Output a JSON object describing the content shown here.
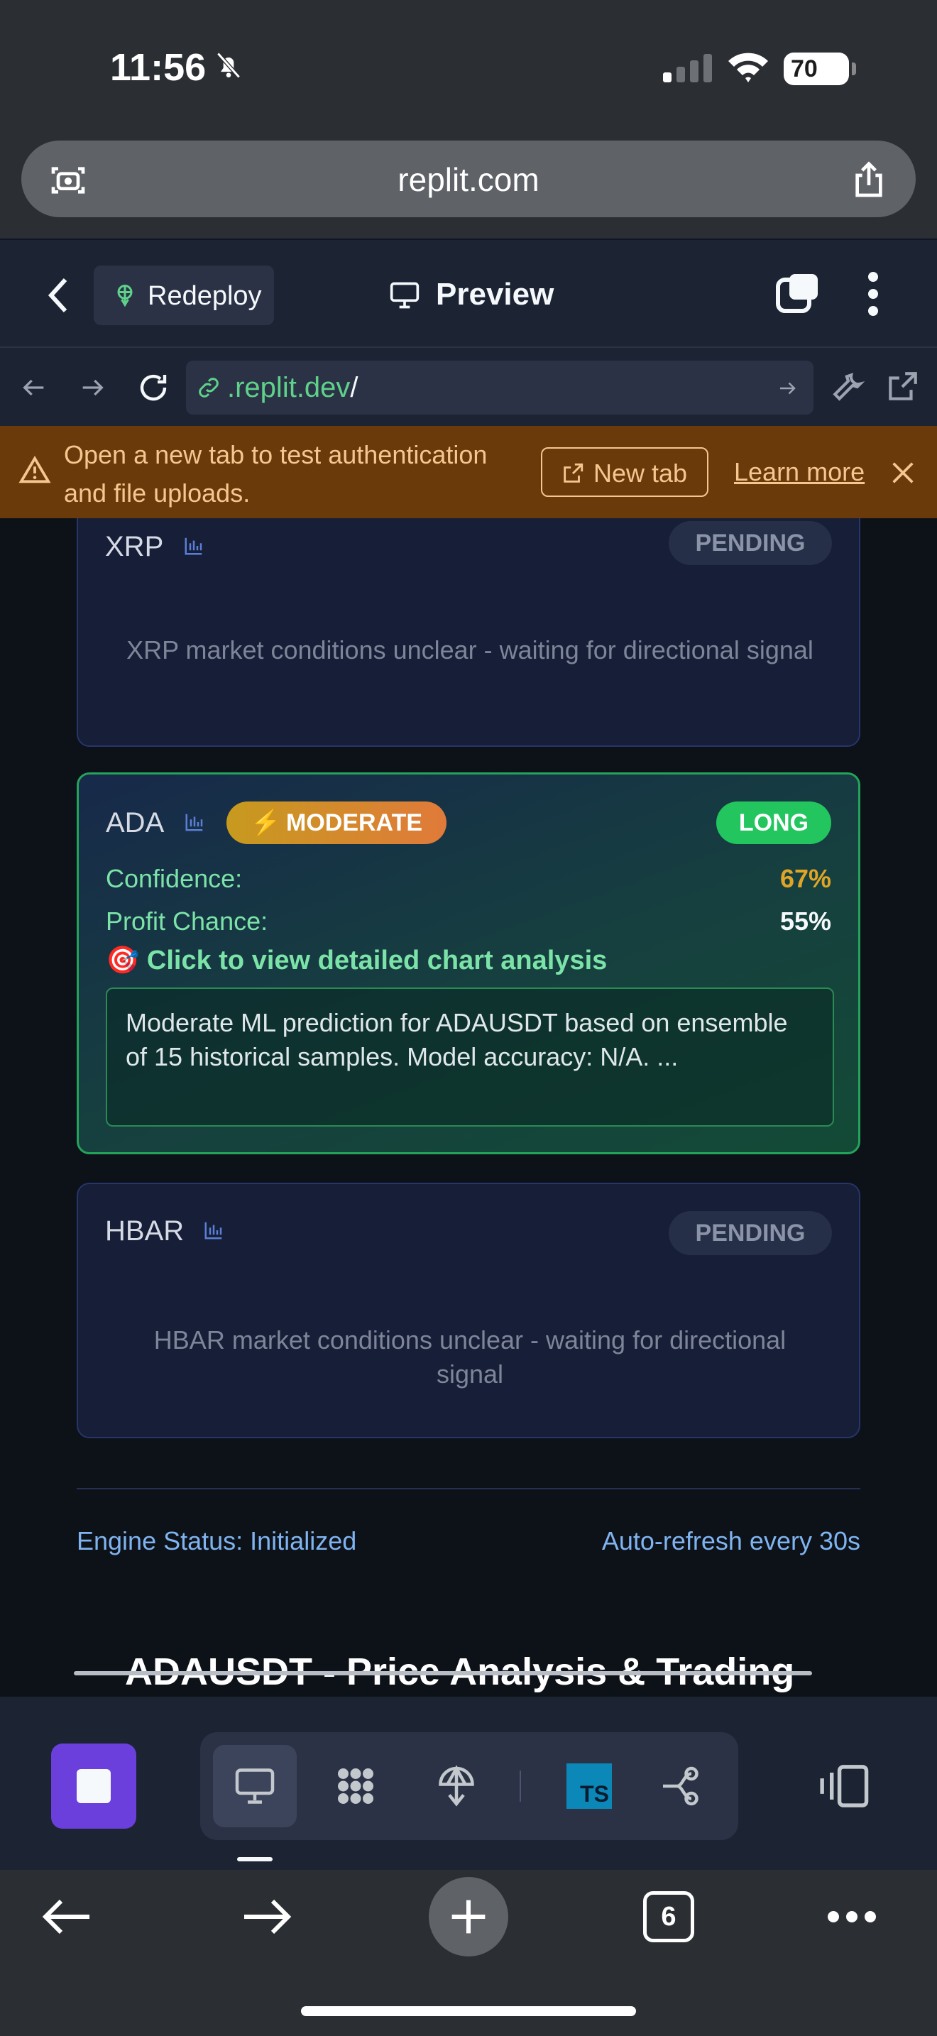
{
  "status_bar": {
    "time": "11:56",
    "battery": "70"
  },
  "browser": {
    "url": "replit.com"
  },
  "replit_header": {
    "redeploy_label": "Redeploy",
    "preview_label": "Preview"
  },
  "webview_nav": {
    "url_domain": ".replit.dev",
    "url_path": "/"
  },
  "banner": {
    "message": "Open a new tab to test authentication and file uploads.",
    "new_tab_label": "New tab",
    "learn_more_label": "Learn more"
  },
  "cards": {
    "xrp": {
      "symbol": "XRP",
      "status": "PENDING",
      "message": "XRP market conditions unclear - waiting for directional signal"
    },
    "ada": {
      "symbol": "ADA",
      "strength": "MODERATE",
      "direction": "LONG",
      "confidence_label": "Confidence:",
      "confidence_value": "67%",
      "profit_label": "Profit Chance:",
      "profit_value": "55%",
      "cta": "Click to view detailed chart analysis",
      "description": "Moderate ML prediction for ADAUSDT based on ensemble of 15 historical samples. Model accuracy: N/A. ..."
    },
    "hbar": {
      "symbol": "HBAR",
      "status": "PENDING",
      "message": "HBAR market conditions unclear - waiting for directional signal"
    }
  },
  "footer": {
    "engine_status": "Engine Status: Initialized",
    "refresh": "Auto-refresh every 30s"
  },
  "next_section_title": "ADAUSDT - Price Analysis & Trading",
  "toolbar": {
    "ts_label": "TS"
  },
  "safari": {
    "tab_count": "6"
  },
  "colors": {
    "confidence": "#e0a526",
    "long_badge": "#22c55e",
    "banner_bg": "#6a3a0a",
    "stop_button": "#6b3fdc"
  }
}
